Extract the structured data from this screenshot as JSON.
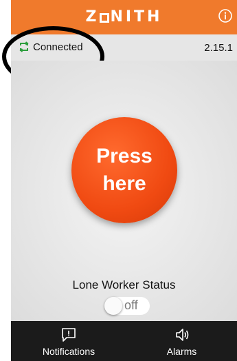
{
  "header": {
    "logo": {
      "pre": "Z",
      "post": "NITH"
    },
    "info_icon": "info-icon",
    "background_color": "#f07a2c"
  },
  "status": {
    "connection_label": "Connected",
    "connection_icon": "sync-icon",
    "connection_icon_color": "#2e9e3e",
    "version": "2.15.1"
  },
  "main": {
    "press_button_label": "Press\nhere",
    "press_button_color": "#f04a12",
    "lone_worker_label": "Lone Worker Status",
    "toggle": {
      "label": "off",
      "state": "off"
    }
  },
  "bottom_nav": {
    "items": [
      {
        "label": "Notifications",
        "icon": "notification-bubble-icon"
      },
      {
        "label": "Alarms",
        "icon": "speaker-icon"
      }
    ]
  }
}
